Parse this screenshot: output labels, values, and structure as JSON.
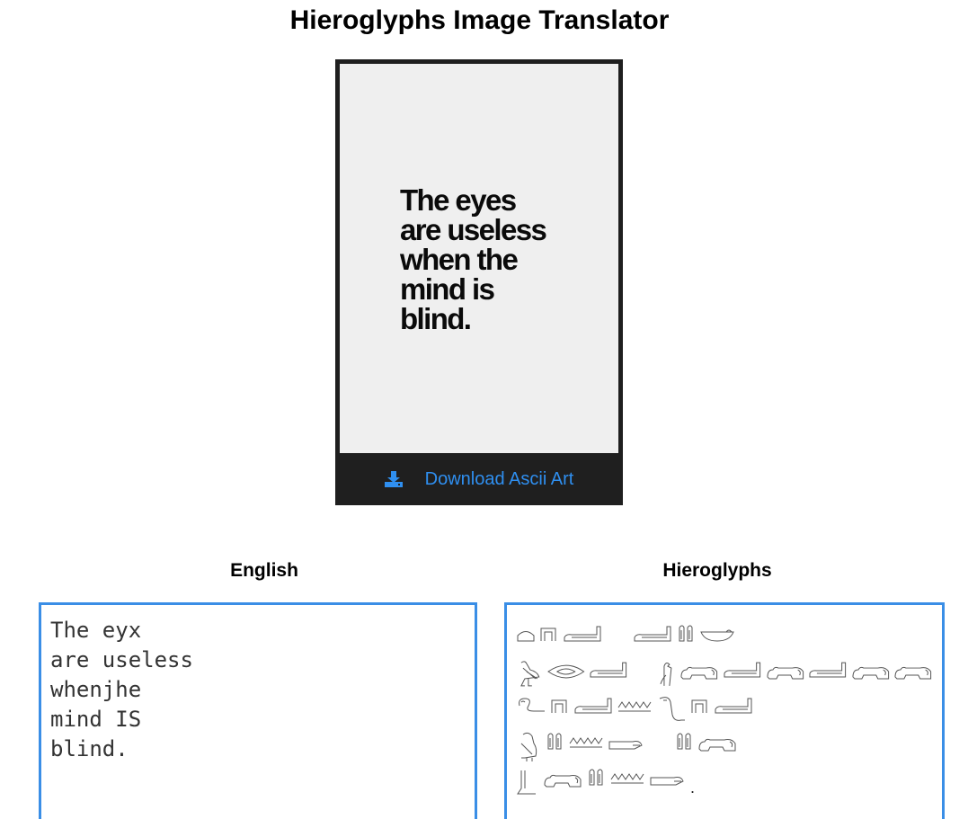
{
  "header": {
    "title": "Hieroglyphs Image Translator"
  },
  "image_card": {
    "poster_text": "The eyes\nare useless\nwhen the\nmind is\nblind.",
    "download_label": "Download Ascii Art",
    "download_icon": "download-icon"
  },
  "english_panel": {
    "label": "English",
    "text": "The eyx\nare useless\nwhenjhe\nmind IS\nblind."
  },
  "hieroglyphs_panel": {
    "label": "Hieroglyphs",
    "lines": [
      "The eyx",
      "are useless",
      "whenjhe",
      "mind IS",
      "blind."
    ]
  },
  "colors": {
    "accent_blue": "#3a8ee6",
    "link_blue": "#2f8ff0",
    "card_dark": "#1f1f1f",
    "preview_bg": "#efefef"
  }
}
